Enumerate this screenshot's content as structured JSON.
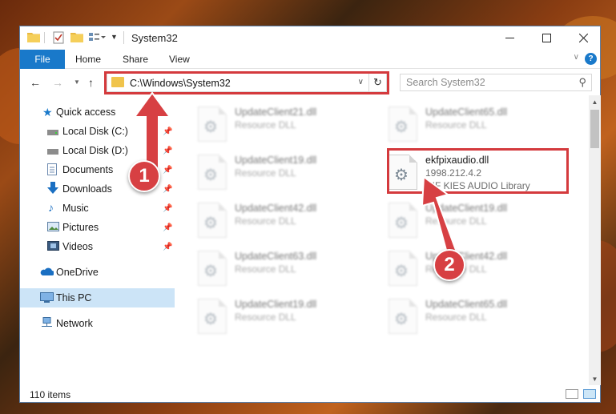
{
  "window": {
    "title": "System32"
  },
  "ribbon": {
    "tabs": [
      "File",
      "Home",
      "Share",
      "View"
    ]
  },
  "address": {
    "path": "C:\\Windows\\System32"
  },
  "search": {
    "placeholder": "Search System32"
  },
  "nav": {
    "items": [
      {
        "label": "Quick access",
        "icon": "star-icon"
      },
      {
        "label": "Local Disk (C:)",
        "icon": "drive-icon",
        "pinned": true
      },
      {
        "label": "Local Disk (D:)",
        "icon": "drive-icon",
        "pinned": true
      },
      {
        "label": "Documents",
        "icon": "documents-icon",
        "pinned": true
      },
      {
        "label": "Downloads",
        "icon": "downloads-icon",
        "pinned": true
      },
      {
        "label": "Music",
        "icon": "music-icon",
        "pinned": true
      },
      {
        "label": "Pictures",
        "icon": "pictures-icon",
        "pinned": true
      },
      {
        "label": "Videos",
        "icon": "videos-icon",
        "pinned": true
      },
      {
        "label": "OneDrive",
        "icon": "onedrive-icon"
      },
      {
        "label": "This PC",
        "icon": "pc-icon",
        "selected": true
      },
      {
        "label": "Network",
        "icon": "network-icon"
      }
    ]
  },
  "files": [
    {
      "name": "UpdateClient21.dll",
      "type": "Resource DLL",
      "blurred": true
    },
    {
      "name": "UpdateClient65.dll",
      "type": "Resource DLL",
      "blurred": true
    },
    {
      "name": "UpdateClient19.dll",
      "type": "Resource DLL",
      "blurred": true
    },
    {
      "name": "ekfpixaudio.dll",
      "version": "1998.212.4.2",
      "description": "NIF KIES AUDIO Library",
      "blurred": false,
      "highlighted": true
    },
    {
      "name": "UpdateClient42.dll",
      "type": "Resource DLL",
      "blurred": true
    },
    {
      "name": "UpdateClient19.dll",
      "type": "Resource DLL",
      "blurred": true
    },
    {
      "name": "UpdateClient63.dll",
      "type": "Resource DLL",
      "blurred": true
    },
    {
      "name": "UpdateClient42.dll",
      "type": "Resource DLL",
      "blurred": true
    },
    {
      "name": "UpdateClient19.dll",
      "type": "Resource DLL",
      "blurred": true
    },
    {
      "name": "UpdateClient65.dll",
      "type": "Resource DLL",
      "blurred": true
    }
  ],
  "status": {
    "item_count": "110 items"
  },
  "annotations": {
    "step1": "1",
    "step2": "2",
    "color": "#d43a3d"
  },
  "colors": {
    "accent": "#1979ca",
    "selection": "#cce4f7",
    "highlight": "#d43a3d"
  }
}
